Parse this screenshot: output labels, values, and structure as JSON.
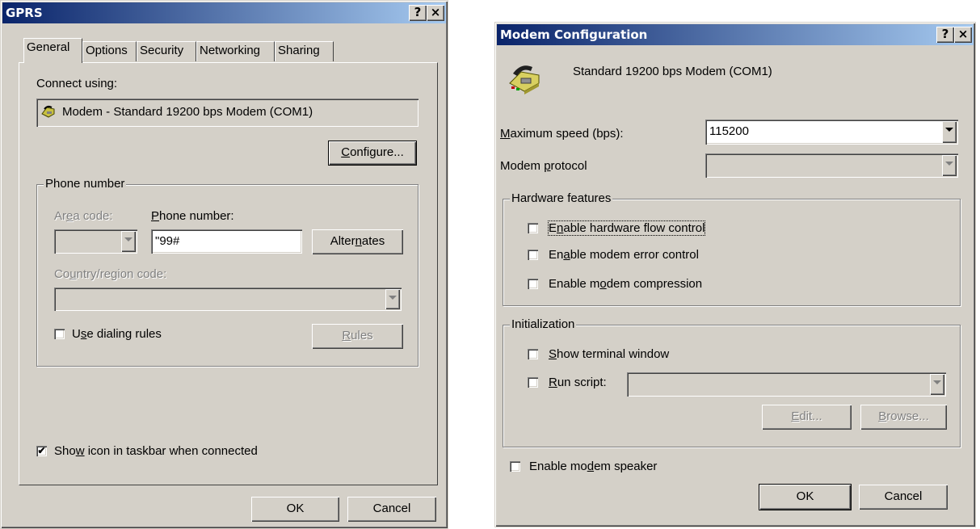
{
  "gprs": {
    "title": "GPRS",
    "help_btn": "?",
    "close_btn": "×",
    "tabs": [
      {
        "label": "General"
      },
      {
        "label": "Options"
      },
      {
        "label": "Security"
      },
      {
        "label": "Networking"
      },
      {
        "label": "Sharing"
      }
    ],
    "active_tab": "General",
    "connect_using_label": "Connect using:",
    "device_name": "Modem - Standard 19200 bps Modem (COM1)",
    "configure_btn_pre": "",
    "configure_btn_key": "C",
    "configure_btn_post": "onfigure...",
    "phone_group_label": "Phone number",
    "area_code_pre": "Ar",
    "area_code_key": "e",
    "area_code_post": "a code:",
    "phone_number_pre": "",
    "phone_number_key": "P",
    "phone_number_post": "hone number:",
    "phone_number_value": "\"99#",
    "alternates_pre": "Alter",
    "alternates_key": "n",
    "alternates_post": "ates",
    "country_pre": "Co",
    "country_key": "u",
    "country_post": "ntry/region code:",
    "use_dialing_pre": "U",
    "use_dialing_key": "s",
    "use_dialing_post": "e dialing rules",
    "use_dialing_checked": false,
    "rules_pre": "",
    "rules_key": "R",
    "rules_post": "ules",
    "show_icon_pre": "Sho",
    "show_icon_key": "w",
    "show_icon_post": " icon in taskbar when connected",
    "show_icon_checked": true,
    "ok_btn": "OK",
    "cancel_btn": "Cancel"
  },
  "modem": {
    "title": "Modem Configuration",
    "help_btn": "?",
    "close_btn": "×",
    "modem_name": "Standard 19200 bps Modem (COM1)",
    "max_speed_key": "M",
    "max_speed_post": "aximum speed (bps):",
    "max_speed_value": "115200",
    "protocol_pre": "Modem ",
    "protocol_key": "p",
    "protocol_post": "rotocol",
    "hardware_group_label": "Hardware features",
    "hw_flow_pre": "E",
    "hw_flow_key": "n",
    "hw_flow_post": "able hardware flow control",
    "hw_flow_checked": false,
    "err_ctrl_pre": "En",
    "err_ctrl_key": "a",
    "err_ctrl_post": "ble modem error control",
    "err_ctrl_checked": false,
    "compress_pre": "Enable m",
    "compress_key": "o",
    "compress_post": "dem compression",
    "compress_checked": false,
    "init_group_label": "Initialization",
    "show_term_key": "S",
    "show_term_post": "how terminal window",
    "show_term_checked": false,
    "run_script_key": "R",
    "run_script_post": "un script:",
    "run_script_checked": false,
    "edit_key": "E",
    "edit_post": "dit...",
    "browse_key": "B",
    "browse_post": "rowse...",
    "speaker_pre": "Enable mo",
    "speaker_key": "d",
    "speaker_post": "em speaker",
    "speaker_checked": false,
    "ok_btn": "OK",
    "cancel_btn": "Cancel"
  }
}
